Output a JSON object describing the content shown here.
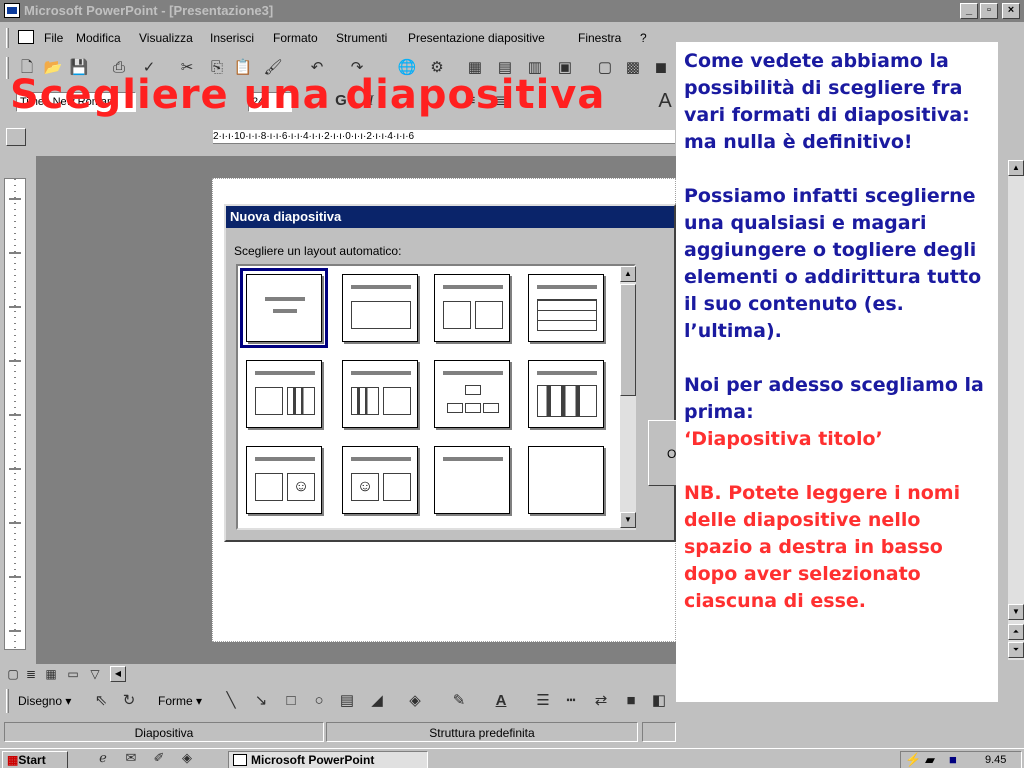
{
  "window": {
    "title": "Microsoft PowerPoint - [Presentazione3]",
    "btn_minimize": "_",
    "btn_restore": "▫",
    "btn_close": "×"
  },
  "menu": {
    "items": [
      "File",
      "Modifica",
      "Visualizza",
      "Inserisci",
      "Formato",
      "Strumenti",
      "Presentazione diapositive",
      "Finestra",
      "?"
    ]
  },
  "formatting": {
    "font_name": "Times New Roman",
    "font_size": "24"
  },
  "slide": {
    "title": "Scegliere una diapositiva"
  },
  "ruler": {
    "labels": "2·ı·ı·10·ı·ı·8·ı·ı·6·ı·ı·4·ı·ı·2·ı·ı·0·ı·ı·2·ı·ı·4·ı·ı·6"
  },
  "dialog": {
    "title": "Nuova diapositiva",
    "label": "Scegliere un layout automatico:",
    "ok_partial": "O"
  },
  "panel": {
    "para1": "Come vedete abbiamo la possibilità di scegliere fra vari formati di diapositiva: ma nulla è definitivo!",
    "para2": "Possiamo infatti sceglierne una qualsiasi e magari aggiungere o togliere degli elementi o addirittura tutto il suo contenuto (es. l’ultima).",
    "para3_a": "Noi per adesso scegliamo la prima:",
    "para3_b": "‘Diapositiva titolo’",
    "para4": "NB. Potete leggere i nomi delle diapositive nello spazio a destra in basso dopo aver selezionato ciascuna di esse."
  },
  "drawbar": {
    "draw_label": "Disegno",
    "shapes_label": "Forme"
  },
  "status": {
    "view": "Diapositiva",
    "design": "Struttura predefinita"
  },
  "taskbar": {
    "start": "Start",
    "task": "Microsoft PowerPoint",
    "clock": "9.45"
  },
  "colors": {
    "title_red": "#ff2020",
    "text_blue": "#1a1aa0",
    "text_red": "#ff3030",
    "dialog_title_bg": "#0a246a"
  }
}
